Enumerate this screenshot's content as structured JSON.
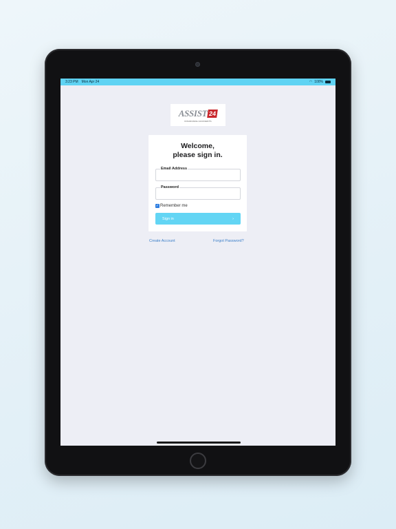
{
  "status_bar": {
    "time": "3:23 PM",
    "date": "Mon Apr 24",
    "battery_percent": "100%",
    "wifi_icon": "wifi-icon",
    "battery_icon": "battery-icon"
  },
  "logo": {
    "name": "ASSIST",
    "badge": "24",
    "tagline": "INSURANCE ACCIDENTS"
  },
  "login": {
    "heading_line1": "Welcome,",
    "heading_line2": "please sign in.",
    "email_label": "Email Address",
    "email_value": "",
    "password_label": "Password",
    "password_value": "",
    "remember_label": "Remember me",
    "remember_checked": true,
    "signin_label": "Sign in",
    "signin_arrow": "›"
  },
  "links": {
    "create_account": "Create Account",
    "forgot_password": "Forgot Password?"
  },
  "colors": {
    "status_bar": "#5fd3f3",
    "button": "#63d5f4",
    "link": "#3a7ec8",
    "badge": "#c8262b"
  }
}
